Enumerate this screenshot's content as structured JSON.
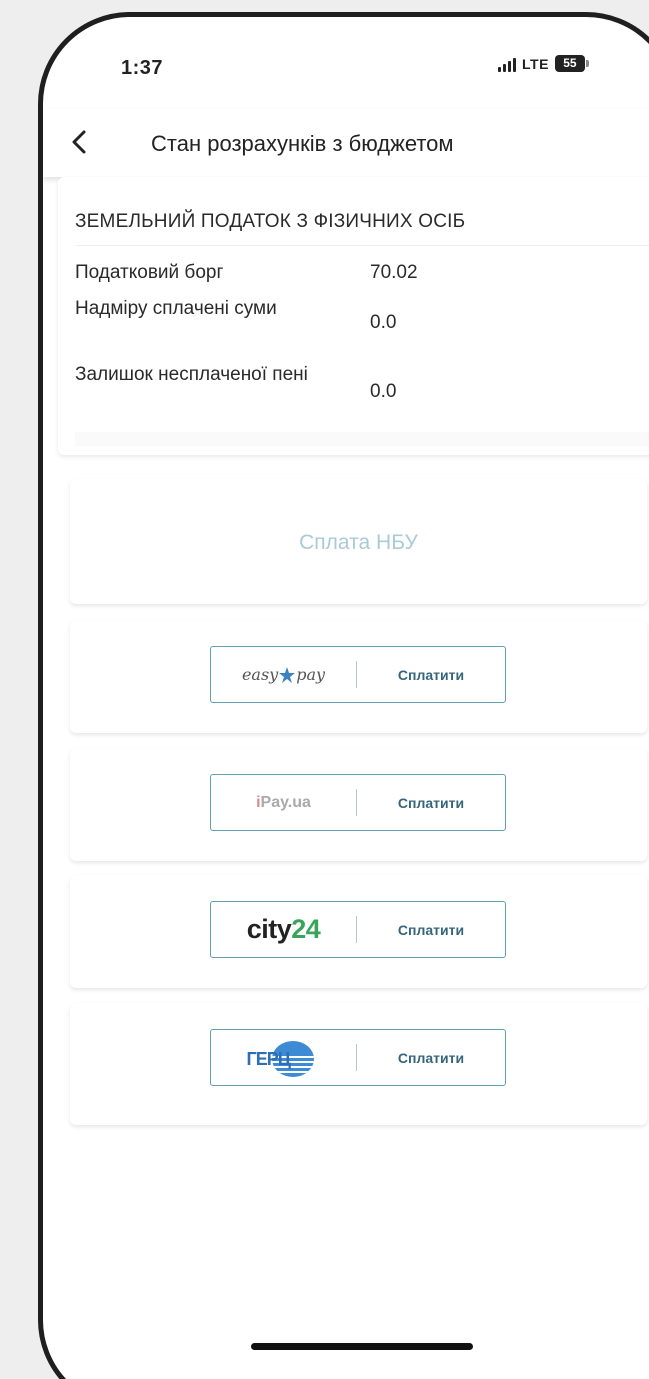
{
  "status_bar": {
    "time": "1:37",
    "network": "LTE",
    "battery": "55"
  },
  "header": {
    "title": "Стан розрахунків з бюджетом"
  },
  "tax_card": {
    "title": "ЗЕМЕЛЬНИЙ ПОДАТОК З ФІЗИЧНИХ ОСІБ",
    "rows": [
      {
        "label": "Податковий борг",
        "value": "70.02"
      },
      {
        "label": "Надміру сплачені суми",
        "value": "0.0"
      },
      {
        "label": "Залишок несплаченої пені",
        "value": "0.0"
      }
    ]
  },
  "payments": {
    "nbu_label": "Сплата НБУ",
    "providers": [
      {
        "logo": "easy pay",
        "logo_left": "easy",
        "logo_right": "pay",
        "action": "Сплатити"
      },
      {
        "logo": "iPay.ua",
        "logo_i": "i",
        "logo_rest": "Pay.ua",
        "action": "Сплатити"
      },
      {
        "logo": "city24",
        "logo_word": "city",
        "logo_num": "24",
        "action": "Сплатити"
      },
      {
        "logo": "ГЕРЦ",
        "action": "Сплатити"
      }
    ]
  },
  "icons": {
    "back": "back-arrow-icon",
    "signal": "signal-icon",
    "battery": "battery-icon",
    "easypay_star": "star-icon"
  }
}
